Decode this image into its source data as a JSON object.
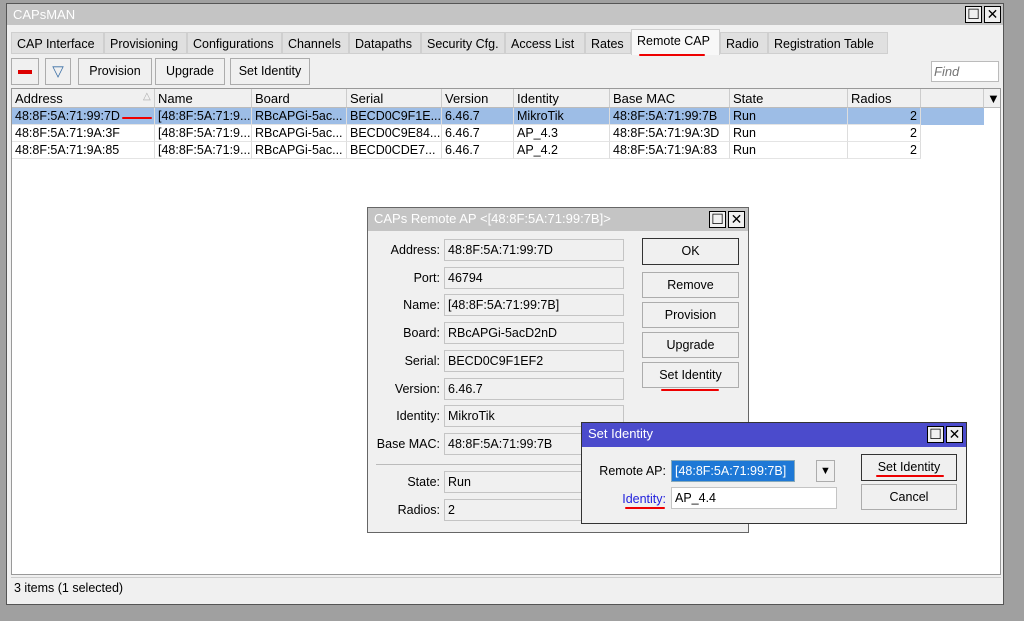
{
  "window": {
    "title": "CAPsMAN"
  },
  "tabs": [
    "CAP Interface",
    "Provisioning",
    "Configurations",
    "Channels",
    "Datapaths",
    "Security Cfg.",
    "Access List",
    "Rates",
    "Remote CAP",
    "Radio",
    "Registration Table"
  ],
  "active_tab": "Remote CAP",
  "toolbar": {
    "provision": "Provision",
    "upgrade": "Upgrade",
    "set_identity": "Set Identity",
    "find_placeholder": "Find"
  },
  "table": {
    "columns": [
      "Address",
      "Name",
      "Board",
      "Serial",
      "Version",
      "Identity",
      "Base MAC",
      "State",
      "Radios"
    ],
    "rows": [
      [
        "48:8F:5A:71:99:7D",
        "[48:8F:5A:71:9...",
        "RBcAPGi-5ac...",
        "BECD0C9F1E...",
        "6.46.7",
        "MikroTik",
        "48:8F:5A:71:99:7B",
        "Run",
        "2"
      ],
      [
        "48:8F:5A:71:9A:3F",
        "[48:8F:5A:71:9...",
        "RBcAPGi-5ac...",
        "BECD0C9E84...",
        "6.46.7",
        "AP_4.3",
        "48:8F:5A:71:9A:3D",
        "Run",
        "2"
      ],
      [
        "48:8F:5A:71:9A:85",
        "[48:8F:5A:71:9...",
        "RBcAPGi-5ac...",
        "BECD0CDE7...",
        "6.46.7",
        "AP_4.2",
        "48:8F:5A:71:9A:83",
        "Run",
        "2"
      ]
    ]
  },
  "status": "3 items (1 selected)",
  "remote_ap_dialog": {
    "title": "CAPs Remote AP <[48:8F:5A:71:99:7B]>",
    "fields": [
      {
        "label": "Address:",
        "value": "48:8F:5A:71:99:7D"
      },
      {
        "label": "Port:",
        "value": "46794"
      },
      {
        "label": "Name:",
        "value": "[48:8F:5A:71:99:7B]"
      },
      {
        "label": "Board:",
        "value": "RBcAPGi-5acD2nD"
      },
      {
        "label": "Serial:",
        "value": "BECD0C9F1EF2"
      },
      {
        "label": "Version:",
        "value": "6.46.7"
      },
      {
        "label": "Identity:",
        "value": "MikroTik"
      },
      {
        "label": "Base MAC:",
        "value": "48:8F:5A:71:99:7B"
      }
    ],
    "state": {
      "label": "State:",
      "value": "Run"
    },
    "radios": {
      "label": "Radios:",
      "value": "2"
    },
    "buttons": {
      "ok": "OK",
      "remove": "Remove",
      "provision": "Provision",
      "upgrade": "Upgrade",
      "set_identity": "Set Identity"
    }
  },
  "set_identity_dialog": {
    "title": "Set Identity",
    "remote_ap_label": "Remote AP:",
    "remote_ap_value": "[48:8F:5A:71:99:7B]",
    "identity_label": "Identity:",
    "identity_value": "AP_4.4",
    "set_identity": "Set Identity",
    "cancel": "Cancel",
    "title_color": "#4b4bcc"
  }
}
